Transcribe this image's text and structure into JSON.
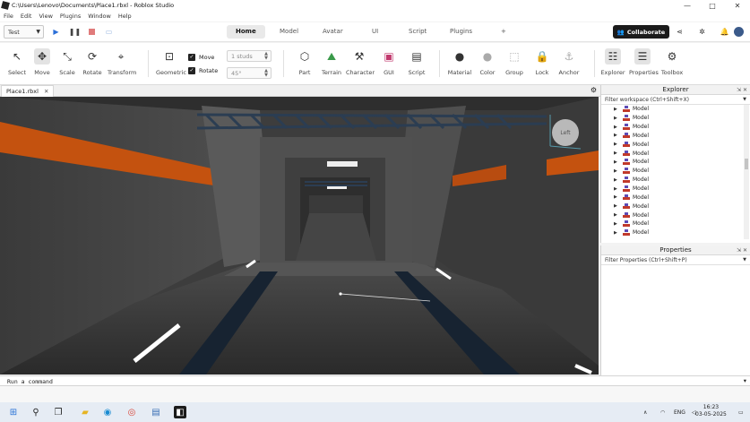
{
  "window": {
    "title": "C:\\Users\\Lenovo\\Documents\\Place1.rbxl - Roblox Studio",
    "minimize": "—",
    "maximize": "□",
    "close": "✕"
  },
  "menu": [
    "File",
    "Edit",
    "View",
    "Plugins",
    "Window",
    "Help"
  ],
  "tabrow": {
    "mode": "Test",
    "tabs": [
      "Home",
      "Model",
      "Avatar",
      "UI",
      "Script",
      "Plugins"
    ],
    "active_tab": "Home",
    "add_tab": "+",
    "collaborate": "Collaborate"
  },
  "toolbar": {
    "select": "Select",
    "move": "Move",
    "scale": "Scale",
    "rotate": "Rotate",
    "transform": "Transform",
    "geometric": "Geometric",
    "move_toggle": "Move",
    "rotate_toggle": "Rotate",
    "move_step": "1 studs",
    "rotate_step": "45°",
    "part": "Part",
    "terrain": "Terrain",
    "character": "Character",
    "gui": "GUI",
    "script": "Script",
    "material": "Material",
    "color": "Color",
    "group": "Group",
    "lock": "Lock",
    "anchor": "Anchor",
    "explorer": "Explorer",
    "properties": "Properties",
    "toolbox": "Toolbox"
  },
  "doc_tab": {
    "label": "Place1.rbxl",
    "close": "✕"
  },
  "viewport": {
    "viewcube_label": "Left"
  },
  "explorer": {
    "title": "Explorer",
    "filter_placeholder": "Filter workspace (Ctrl+Shift+X)",
    "items": [
      "Model",
      "Model",
      "Model",
      "Model",
      "Model",
      "Model",
      "Model",
      "Model",
      "Model",
      "Model",
      "Model",
      "Model",
      "Model",
      "Model",
      "Model"
    ]
  },
  "properties": {
    "title": "Properties",
    "filter_placeholder": "Filter Properties (Ctrl+Shift+P)"
  },
  "command_bar": {
    "placeholder": "Run a command"
  },
  "taskbar": {
    "language": "ENG",
    "time": "16:23",
    "date": "03-05-2025"
  },
  "colors": {
    "accent_orange": "#c4520f",
    "collab_bg": "#1b1b1b",
    "model_icon_red": "#c0392b",
    "model_icon_blue": "#5d4bb5"
  }
}
